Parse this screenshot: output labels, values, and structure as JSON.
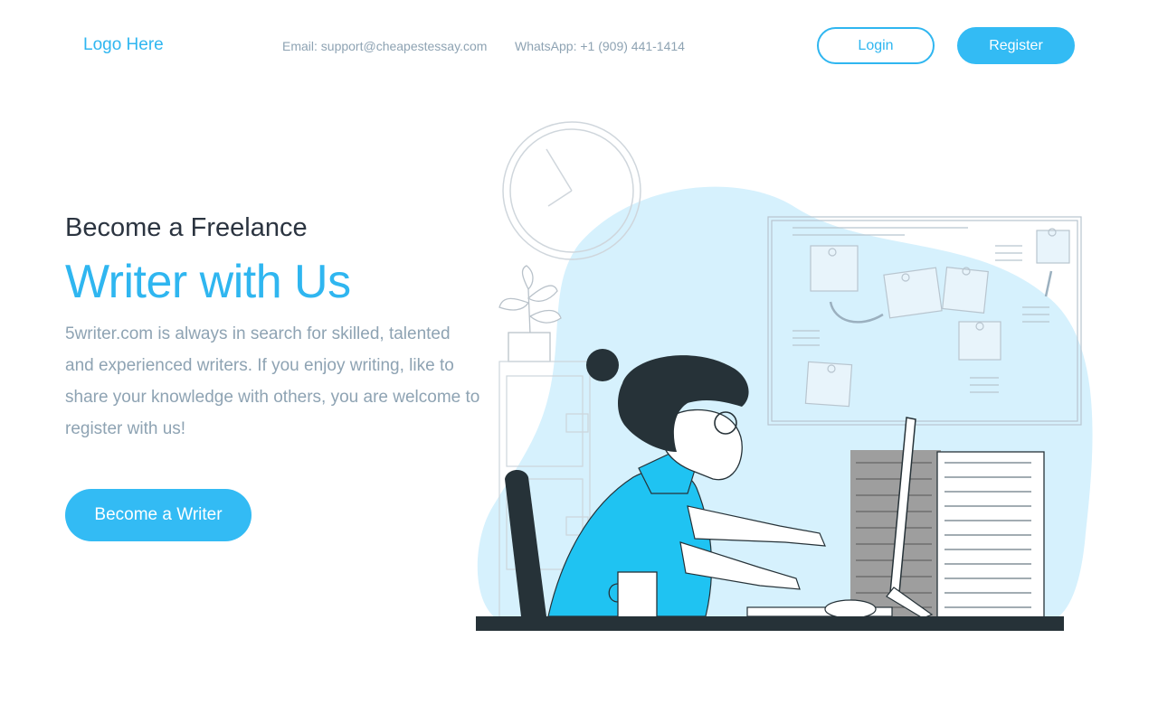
{
  "header": {
    "logo": "Logo Here",
    "email": "Email: support@cheapestessay.com",
    "whatsapp": "WhatsApp: +1 (909) 441-1414",
    "login_label": "Login",
    "register_label": "Register"
  },
  "hero": {
    "subtitle": "Become a Freelance",
    "title": "Writer with Us",
    "description": "5writer.com is always in search for skilled, talented and experienced writers. If you enjoy writing, like to share your knowledge with others, you are welcome to register with us!",
    "cta_label": "Become a Writer"
  },
  "colors": {
    "accent": "#33bbf4",
    "text_dark": "#2b3440",
    "text_muted": "#8ea3b3",
    "blob": "#d6f1fd",
    "shirt": "#1fc3f2"
  },
  "illustration": {
    "icon": "woman-typing-at-desk-illustration"
  }
}
